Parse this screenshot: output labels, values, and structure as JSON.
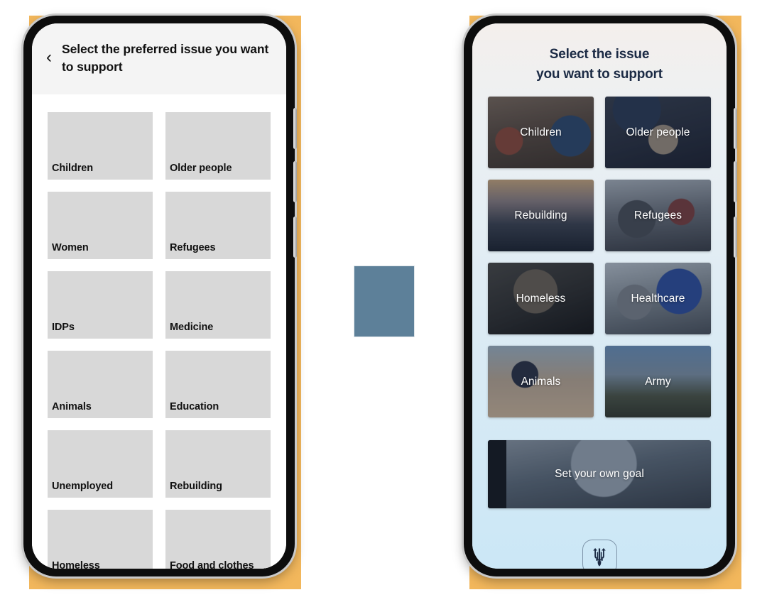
{
  "canvas": {
    "backdrop_color": "#f2b75c",
    "page_background": "#ffffff"
  },
  "center_placeholder": {
    "name": "image-placeholder",
    "color": "#5d8099"
  },
  "left_phone": {
    "screen_background": "#ffffff",
    "header": {
      "background": "#f4f4f4",
      "back_icon": "‹",
      "title": "Select the preferred issue you want to support"
    },
    "cards": [
      {
        "label": "Children"
      },
      {
        "label": "Older people"
      },
      {
        "label": "Women"
      },
      {
        "label": "Refugees"
      },
      {
        "label": "IDPs"
      },
      {
        "label": "Medicine"
      },
      {
        "label": "Animals"
      },
      {
        "label": "Education"
      },
      {
        "label": "Unemployed"
      },
      {
        "label": "Rebuilding"
      },
      {
        "label": "Homeless"
      },
      {
        "label": "Food and clothes"
      }
    ],
    "card_color": "#d8d8d8",
    "label_color": "#111111"
  },
  "right_phone": {
    "title_line1": "Select the issue",
    "title_line2": "you want to support",
    "title_color": "#1b2a44",
    "gradient_top": "#f4efec",
    "gradient_bottom": "#cbe7f6",
    "tiles": [
      {
        "label": "Children",
        "photo": "ph-children"
      },
      {
        "label": "Older people",
        "photo": "ph-older"
      },
      {
        "label": "Rebuilding",
        "photo": "ph-rebuilding"
      },
      {
        "label": "Refugees",
        "photo": "ph-refugees"
      },
      {
        "label": "Homeless",
        "photo": "ph-homeless"
      },
      {
        "label": "Healthcare",
        "photo": "ph-healthcare"
      },
      {
        "label": "Animals",
        "photo": "ph-animals"
      },
      {
        "label": "Army",
        "photo": "ph-army"
      }
    ],
    "wide_tile": {
      "label": "Set your own goal",
      "photo": "ph-goal"
    },
    "logo": {
      "name": "ukraine-trident-logo",
      "color": "#1b2a44"
    }
  }
}
